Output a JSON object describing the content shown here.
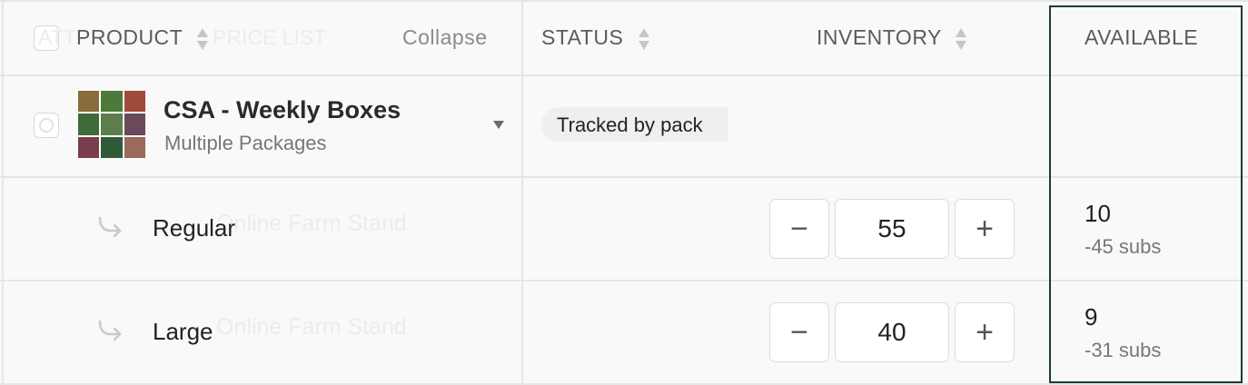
{
  "header": {
    "ghost_attr": "ATT",
    "product_label": "PRODUCT",
    "price_list_label": "PRICE LIST",
    "collapse_label": "Collapse",
    "status_label": "STATUS",
    "inventory_label": "INVENTORY",
    "available_label": "AVAILABLE"
  },
  "product": {
    "name": "CSA - Weekly Boxes",
    "subtitle": "Multiple Packages",
    "status": "Tracked by pack"
  },
  "variants": [
    {
      "name": "Regular",
      "price_list": "Online Farm Stand",
      "inventory": "55",
      "decrement": "−",
      "increment": "+",
      "available": "10",
      "subs": "-45 subs"
    },
    {
      "name": "Large",
      "price_list": "Online Farm Stand",
      "inventory": "40",
      "decrement": "−",
      "increment": "+",
      "available": "9",
      "subs": "-31 subs"
    }
  ],
  "colors": {
    "available_border": "#1e3a34",
    "status_pill_bg": "#efefef",
    "grid_line": "#e6e6e6"
  },
  "icons": {
    "sort": "sort-icon",
    "expand": "caret-down-icon",
    "child_row": "corner-down-right-icon"
  }
}
